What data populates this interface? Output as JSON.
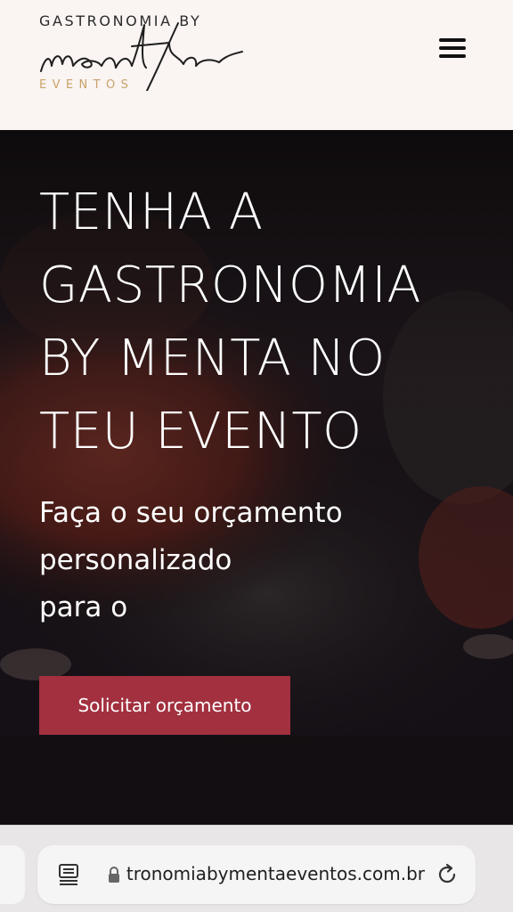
{
  "header": {
    "logo": {
      "top_text": "GASTRONOMIA BY",
      "script_text": "menta",
      "bottom_text": "EVENTOS",
      "accent_color": "#c9a36a"
    },
    "menu_icon": "hamburger-menu-icon"
  },
  "hero": {
    "title": "TENHA A GASTRONOMIA BY MENTA NO TEU EVENTO",
    "subtitle_lines": [
      "Faça o seu orçamento",
      "personalizado",
      "para o"
    ],
    "cta_label": "Solicitar orçamento",
    "cta_color": "#a2303f"
  },
  "browser": {
    "url": "gastronomiabymentaeventos.com.br",
    "reader_icon": "reader-mode-icon",
    "lock_icon": "lock-icon",
    "reload_icon": "reload-icon"
  }
}
